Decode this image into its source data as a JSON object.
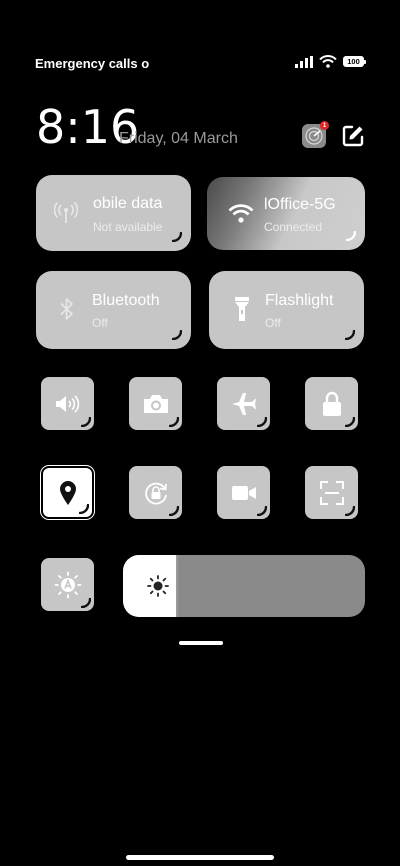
{
  "status_bar": {
    "carrier_text": "Emergency calls o",
    "battery_level": "100"
  },
  "header": {
    "time": "8:16",
    "date": "Friday, 04 March",
    "notification_badge": "1"
  },
  "tiles": {
    "mobile_data": {
      "title": "obile data",
      "status": "Not available"
    },
    "wifi": {
      "title": "lOffice-5G",
      "status": "Connected"
    },
    "bluetooth": {
      "title": "Bluetooth",
      "status": "Off"
    },
    "flashlight": {
      "title": "Flashlight",
      "status": "Off"
    }
  },
  "brightness": {
    "level_percent": 22
  },
  "colors": {
    "tile": "#c6c6c6",
    "active_tile": "#ffffff",
    "track": "#8a8a8a",
    "badge": "#e0262a"
  }
}
